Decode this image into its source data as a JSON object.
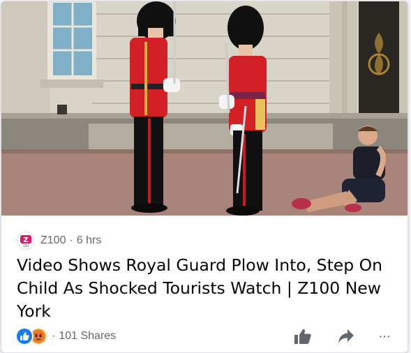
{
  "post": {
    "image_alt": "Royal guards at Buckingham Palace with a child sitting on the ground",
    "source": {
      "name": "Z100",
      "logo_text": "Z",
      "logo_subtext": "100",
      "separator": "·",
      "time": "6 hrs"
    },
    "headline": "Video Shows Royal Guard Plow Into, Step On Child As Shocked Tourists Watch | Z100 New York",
    "reactions": {
      "icons": [
        "like-icon",
        "angry-icon"
      ],
      "separator": "·",
      "shares_label": "101 Shares"
    },
    "actions": {
      "like_icon": "thumbs-up-icon",
      "share_icon": "share-arrow-icon",
      "more_label": "···"
    }
  },
  "colors": {
    "brand_blue": "#1877f2",
    "angry_orange": "#f7a531",
    "logo_pink": "#e0186c",
    "text_primary": "#050505",
    "text_secondary": "#65676b"
  }
}
